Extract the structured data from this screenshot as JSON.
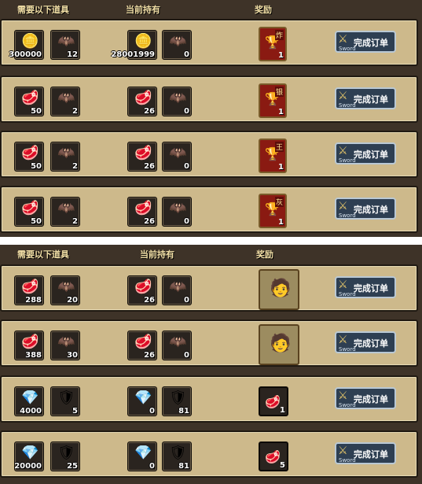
{
  "headers": {
    "need": "需要以下道具",
    "have": "当前持有",
    "reward": "奖励"
  },
  "button": {
    "label": "完成订单",
    "sub": "Sword"
  },
  "rows_top": [
    {
      "need": [
        {
          "icon": "gold-coin-icon",
          "glyph": "🪙",
          "count": "300000"
        },
        {
          "icon": "bat-wing-icon",
          "glyph": "🦇",
          "count": "12"
        }
      ],
      "have": [
        {
          "icon": "gold-coin-icon",
          "glyph": "🪙",
          "count": "28001999"
        },
        {
          "icon": "bat-wing-icon",
          "glyph": "🦇",
          "count": "0"
        }
      ],
      "reward": {
        "glyph": "🏆",
        "tag": "炸",
        "count": "1"
      }
    },
    {
      "need": [
        {
          "icon": "red-meat-icon",
          "glyph": "🥩",
          "count": "50"
        },
        {
          "icon": "bat-wing-icon",
          "glyph": "🦇",
          "count": "2"
        }
      ],
      "have": [
        {
          "icon": "red-meat-icon",
          "glyph": "🥩",
          "count": "26"
        },
        {
          "icon": "bat-wing-icon",
          "glyph": "🦇",
          "count": "0"
        }
      ],
      "reward": {
        "glyph": "🏆",
        "tag": "银",
        "count": "1"
      }
    },
    {
      "need": [
        {
          "icon": "red-meat-icon",
          "glyph": "🥩",
          "count": "50"
        },
        {
          "icon": "bat-wing-icon",
          "glyph": "🦇",
          "count": "2"
        }
      ],
      "have": [
        {
          "icon": "red-meat-icon",
          "glyph": "🥩",
          "count": "26"
        },
        {
          "icon": "bat-wing-icon",
          "glyph": "🦇",
          "count": "0"
        }
      ],
      "reward": {
        "glyph": "🏆",
        "tag": "王",
        "count": "1"
      }
    },
    {
      "need": [
        {
          "icon": "red-meat-icon",
          "glyph": "🥩",
          "count": "50"
        },
        {
          "icon": "bat-wing-icon",
          "glyph": "🦇",
          "count": "2"
        }
      ],
      "have": [
        {
          "icon": "red-meat-icon",
          "glyph": "🥩",
          "count": "26"
        },
        {
          "icon": "bat-wing-icon",
          "glyph": "🦇",
          "count": "0"
        }
      ],
      "reward": {
        "glyph": "🏆",
        "tag": "灰",
        "count": "1"
      }
    }
  ],
  "rows_bottom": [
    {
      "need": [
        {
          "icon": "red-meat-icon",
          "glyph": "🥩",
          "count": "288"
        },
        {
          "icon": "bat-wing-icon",
          "glyph": "🦇",
          "count": "20"
        }
      ],
      "have": [
        {
          "icon": "red-meat-icon",
          "glyph": "🥩",
          "count": "26"
        },
        {
          "icon": "bat-wing-icon",
          "glyph": "🦇",
          "count": "0"
        }
      ],
      "reward": {
        "glyph": "🧑",
        "count": ""
      }
    },
    {
      "need": [
        {
          "icon": "red-meat-icon",
          "glyph": "🥩",
          "count": "388"
        },
        {
          "icon": "bat-wing-icon",
          "glyph": "🦇",
          "count": "30"
        }
      ],
      "have": [
        {
          "icon": "red-meat-icon",
          "glyph": "🥩",
          "count": "26"
        },
        {
          "icon": "bat-wing-icon",
          "glyph": "🦇",
          "count": "0"
        }
      ],
      "reward": {
        "glyph": "🧑",
        "count": ""
      }
    },
    {
      "need": [
        {
          "icon": "green-crystal-icon",
          "glyph": "💎",
          "count": "4000"
        },
        {
          "icon": "gold-armor-icon",
          "glyph": "🛡",
          "count": "5"
        }
      ],
      "have": [
        {
          "icon": "green-crystal-icon",
          "glyph": "💎",
          "count": "0"
        },
        {
          "icon": "gold-armor-icon",
          "glyph": "🛡",
          "count": "81"
        }
      ],
      "reward": {
        "glyph": "🥩",
        "count": "1"
      }
    },
    {
      "need": [
        {
          "icon": "green-crystal-icon",
          "glyph": "💎",
          "count": "20000"
        },
        {
          "icon": "gold-armor-icon",
          "glyph": "🛡",
          "count": "25"
        }
      ],
      "have": [
        {
          "icon": "green-crystal-icon",
          "glyph": "💎",
          "count": "0"
        },
        {
          "icon": "gold-armor-icon",
          "glyph": "🛡",
          "count": "81"
        }
      ],
      "reward": {
        "glyph": "🥩",
        "count": "5"
      }
    }
  ]
}
